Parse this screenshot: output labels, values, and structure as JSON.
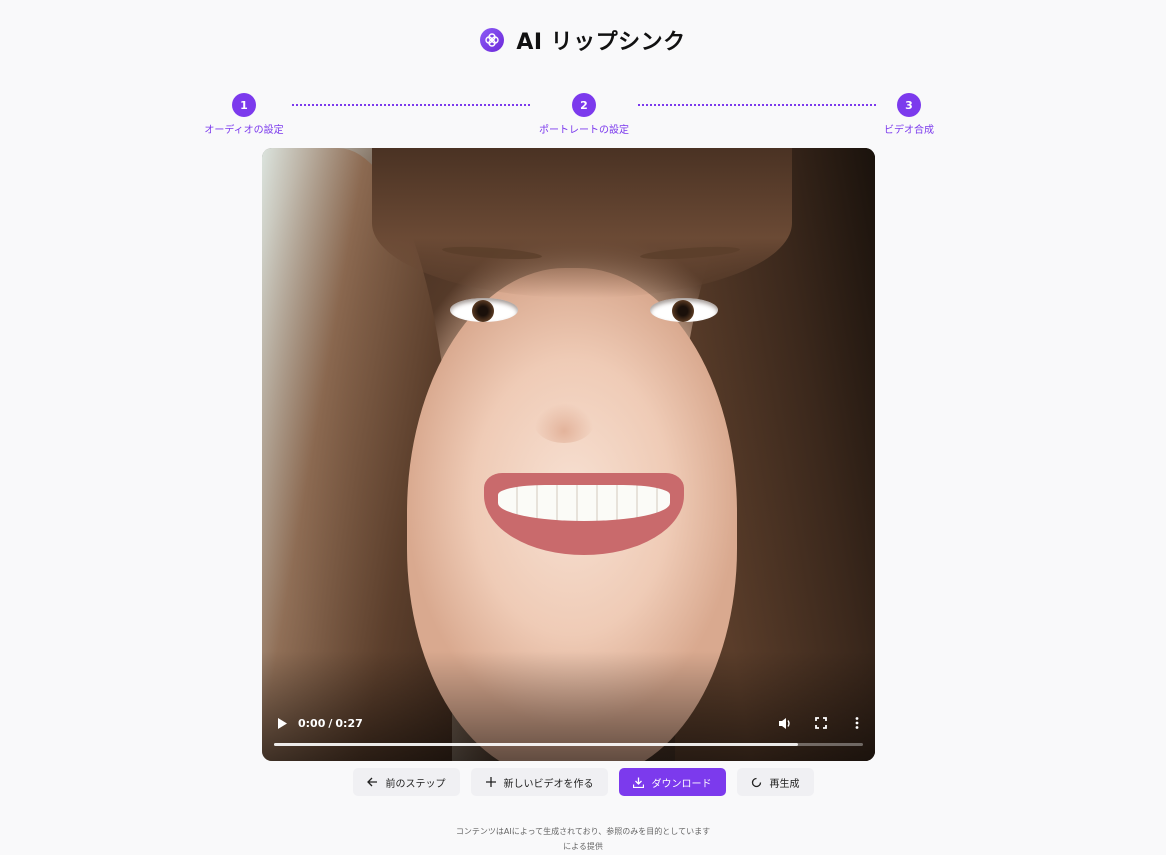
{
  "app": {
    "title": "AI リップシンク",
    "logo_icon": "flower-logo-icon",
    "accent_color": "#7c3aed"
  },
  "stepper": {
    "steps": [
      {
        "number": "1",
        "label": "オーディオの設定"
      },
      {
        "number": "2",
        "label": "ポートレートの設定"
      },
      {
        "number": "3",
        "label": "ビデオ合成"
      }
    ]
  },
  "video": {
    "current_time": "0:00",
    "duration": "0:27",
    "progress_fraction": 0.89
  },
  "actions": {
    "prev_label": "前のステップ",
    "new_video_label": "新しいビデオを作る",
    "download_label": "ダウンロード",
    "regenerate_label": "再生成"
  },
  "footer": {
    "disclaimer": "コンテンツはAIによって生成されており、参照のみを目的としています",
    "provided_by": "による提供"
  }
}
